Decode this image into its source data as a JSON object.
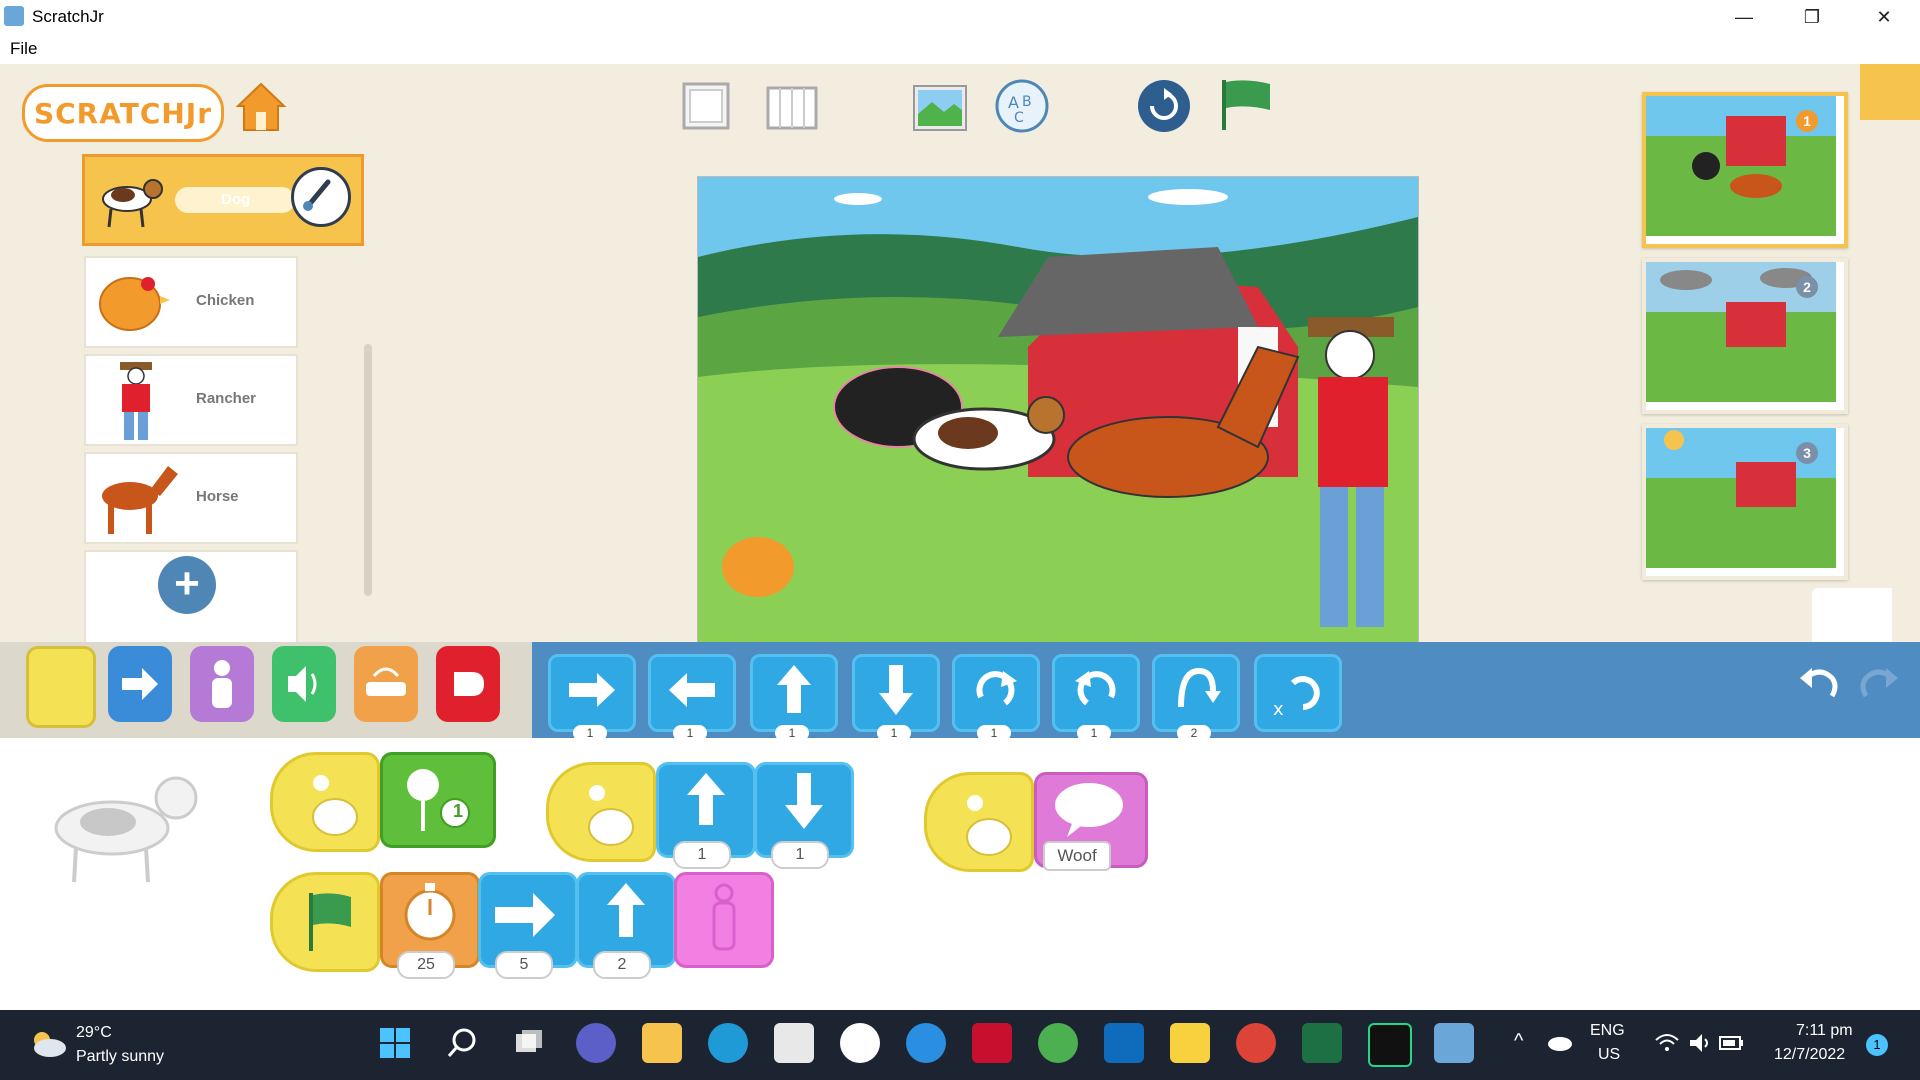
{
  "window": {
    "title": "ScratchJr",
    "minimize": "—",
    "restore": "❐",
    "close": "✕"
  },
  "menu": {
    "file": "File"
  },
  "logo": "SCRATCHJr",
  "sprites": [
    {
      "label": "Dog",
      "selected": true
    },
    {
      "label": "Chicken",
      "selected": false
    },
    {
      "label": "Rancher",
      "selected": false
    },
    {
      "label": "Horse",
      "selected": false
    }
  ],
  "add_sprite": "+",
  "toolbar_icons": [
    "fullscreen-icon",
    "grid-icon",
    "background-icon",
    "text-icon",
    "reset-icon",
    "green-flag-icon"
  ],
  "pages": [
    {
      "number": "1",
      "selected": true
    },
    {
      "number": "2",
      "selected": false
    },
    {
      "number": "3",
      "selected": false
    }
  ],
  "categories": [
    {
      "name": "triggering",
      "color": "#f5e254"
    },
    {
      "name": "motion",
      "color": "#3a8bd8"
    },
    {
      "name": "looks",
      "color": "#b57ad6"
    },
    {
      "name": "sound",
      "color": "#3fc06a"
    },
    {
      "name": "control",
      "color": "#f0a14a"
    },
    {
      "name": "end",
      "color": "#e0202c"
    }
  ],
  "motion_blocks": [
    {
      "name": "move-right",
      "value": "1"
    },
    {
      "name": "move-left",
      "value": "1"
    },
    {
      "name": "move-up",
      "value": "1"
    },
    {
      "name": "move-down",
      "value": "1"
    },
    {
      "name": "turn-right",
      "value": "1"
    },
    {
      "name": "turn-left",
      "value": "1"
    },
    {
      "name": "hop",
      "value": "2"
    },
    {
      "name": "go-home",
      "value": ""
    }
  ],
  "scripts": {
    "script1": {
      "sound_value": "1"
    },
    "script2": {
      "up_value": "1",
      "down_value": "1"
    },
    "script3": {
      "say_text": "Woof"
    },
    "script4": {
      "wait_value": "25",
      "right_value": "5",
      "up_value": "2"
    }
  },
  "taskbar": {
    "temp": "29°C",
    "weather": "Partly sunny",
    "lang1": "ENG",
    "lang2": "US",
    "time": "7:11 pm",
    "date": "12/7/2022",
    "notif": "1"
  }
}
